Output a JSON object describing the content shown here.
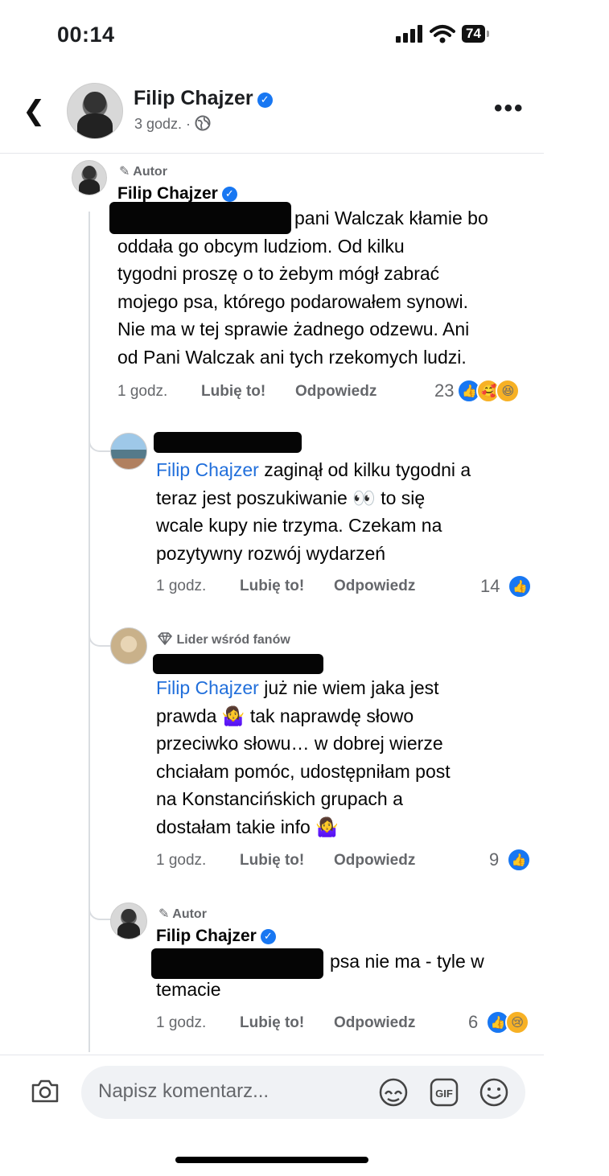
{
  "status_bar": {
    "time": "00:14",
    "battery": "74"
  },
  "header": {
    "name": "Filip Chajzer",
    "meta": "3 godz. ·"
  },
  "comments": [
    {
      "badge": "Autor",
      "name": "Filip Chajzer",
      "lines": [
        "pani Walczak kłamie bo",
        "oddała go obcym ludziom. Od kilku",
        "tygodni proszę o to żebym mógł zabrać",
        "mojego psa, którego podarowałem synowi.",
        "Nie ma w tej sprawie żadnego odzewu. Ani",
        "od Pani Walczak ani tych rzekomych ludzi."
      ],
      "time": "1 godz.",
      "like": "Lubię to!",
      "reply": "Odpowiedz",
      "reactions": "23"
    },
    {
      "mention": "Filip Chajzer",
      "lines": [
        " zaginął od kilku tygodni a",
        "teraz jest poszukiwanie 👀 to się",
        "wcale kupy nie trzyma. Czekam na",
        "pozytywny rozwój wydarzeń"
      ],
      "time": "1 godz.",
      "like": "Lubię to!",
      "reply": "Odpowiedz",
      "reactions": "14"
    },
    {
      "badge": "Lider wśród fanów",
      "mention": "Filip Chajzer",
      "lines": [
        " już nie wiem jaka jest",
        "prawda 🤷‍♀️ tak naprawdę słowo",
        "przeciwko słowu… w dobrej wierze",
        "chciałam pomóc, udostępniłam post",
        "na Konstancińskich grupach a",
        "dostałam takie info 🤷‍♀️"
      ],
      "time": "1 godz.",
      "like": "Lubię to!",
      "reply": "Odpowiedz",
      "reactions": "9"
    },
    {
      "badge": "Autor",
      "name": "Filip Chajzer",
      "lines": [
        "psa nie ma - tyle w",
        "temacie"
      ],
      "time": "1 godz.",
      "like": "Lubię to!",
      "reply": "Odpowiedz",
      "reactions": "6"
    }
  ],
  "composer": {
    "placeholder": "Napisz komentarz..."
  }
}
